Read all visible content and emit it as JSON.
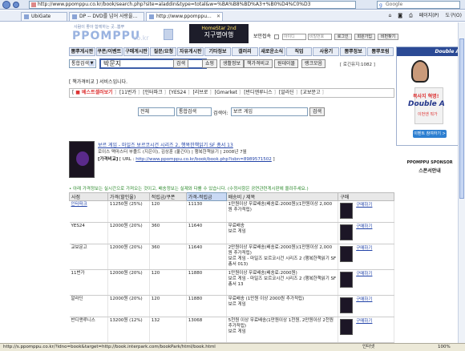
{
  "browser": {
    "address": "http://www.ppomppu.co.kr/book/search.php?site=aladdin&type=total&w=%BA%B8%BD%A3+%B0%D4%C0%D3",
    "search_placeholder": "Google",
    "tabs": [
      "UbiGate",
      "DP -- DVD를 넘어 사랑을...",
      "http://www.ppomppu..."
    ],
    "tools": [
      "페이지(P)",
      "도구(O)"
    ]
  },
  "site": {
    "tagline": "사람이 좋아 함께하는 곳..뽐뿌",
    "logo": "PPOMPPU",
    "logo_sub": "co.kr",
    "banner_top": "HomeStar 2nd",
    "banner_bottom": "지구별여행",
    "util_auto": "보안접속",
    "util_id": "아이디",
    "util_pw": "비밀번호",
    "util_login": "로그인",
    "util_join": "회원가입",
    "util_find": "비번찾기"
  },
  "menu": [
    "뽐뿌게시판",
    "쿠폰/이벤트",
    "구매게시판",
    "질문/요청",
    "자유게시판",
    "기타정보",
    "갤러리",
    "새로운소식",
    "직업",
    "사용기",
    "뽐뿌정보",
    "뽐뿌포럼"
  ],
  "search": {
    "mode": "통합검색",
    "query": "박문지",
    "submit": "검색",
    "btns": [
      "쇼핑",
      "생활정보",
      "책가격비교",
      "원데이몰",
      "랭크모음"
    ],
    "login_remain": "[ 로긴유지:1082 ]"
  },
  "book_section": {
    "title": "[ 책가격비교 ] 서비스입니다.",
    "tabs": [
      "베스트셀러보기",
      "11번가",
      "인터파크",
      "YES24",
      "리브로",
      "Gmarket",
      "반디앤루니스",
      "알라딘",
      "교보문고"
    ],
    "filter_cat": "전체",
    "filter_type": "통합검색",
    "filter_label": "검색어:",
    "filter_query": "보르 게임",
    "filter_btn": "검색"
  },
  "product": {
    "title": "보르 게임 - 마일즈 보르코시건 시리즈 2, 행복한책읽기 SF 총서 13",
    "meta": "로이스 맥마스터 부졸드 (지은이), 김상훈 (옮긴이) | 행복한책읽기 | 2008년 7월",
    "compare_label": "[가격비교]",
    "compare_url": "http://www.ppomppu.co.kr/book/book.php?isbn=8989571502"
  },
  "note": "• 아래 가격정보는 실시간으로 가져오는 것이고, 배송정보는 실제와 다를 수 있습니다. (수정사항은 공연관련게시판에 올려주세요.)",
  "table": {
    "headers": [
      "사점",
      "가격(할인율)",
      "적립금/쿠폰",
      "가격-적립금",
      "배송비 / 제목",
      "구매"
    ],
    "buy_label": "구매하기",
    "rows": [
      {
        "store": "인터파크",
        "price": "11250원 (25%)",
        "mileage": "120",
        "net": "11130",
        "info": "1만원이상 무료배송(배송료:2000원)(1만원이상 2,000원 추가적립)"
      },
      {
        "store": "YES24",
        "price": "12000원 (20%)",
        "mileage": "360",
        "net": "11640",
        "info": "무료배송\n보르 게임"
      },
      {
        "store": "교보문고",
        "price": "12000원 (20%)",
        "mileage": "360",
        "net": "11640",
        "info": "2만원이상 무료배송(배송료:2000원)(1만원이상 2,000원 추가적립)\n보르 게임 - 마일즈 보르코시건 시리즈 2 (행복한책읽기 SF총서 013)"
      },
      {
        "store": "11번가",
        "price": "12000원 (20%)",
        "mileage": "120",
        "net": "11880",
        "info": "1만원이상 무료배송(배송료:2000원)\n보르 게임 - 마일즈 보르코시건 시리즈 2 (행복한책읽기 SF 총서 13"
      },
      {
        "store": "알라딘",
        "price": "12000원 (20%)",
        "mileage": "120",
        "net": "11880",
        "info": "무료배송 (1만원 이상 2000원 추가적립)\n보르 게임"
      },
      {
        "store": "반디앤루니스",
        "price": "13200원 (12%)",
        "mileage": "132",
        "net": "13068",
        "info": "5천원 이상 무료배송(1만원이상 1천원, 2만원이상 2천원 추가적립)\n보르 게임"
      }
    ]
  },
  "ad": {
    "head": "Double A",
    "line1": "복사지 혁명!",
    "line2": "Double A",
    "line3": "이번엔 뭐가",
    "cta": "이벤트 참여하기 >",
    "sponsor1": "PPOMPPU SPONSOR",
    "sponsor2": "스폰서안내"
  },
  "status": {
    "url": "http://s.ppomppu.co.kr/?idno=book&target=http://book.interpark.com/bookPark/html/book.html",
    "zone": "인터넷",
    "zoom": "100%"
  }
}
